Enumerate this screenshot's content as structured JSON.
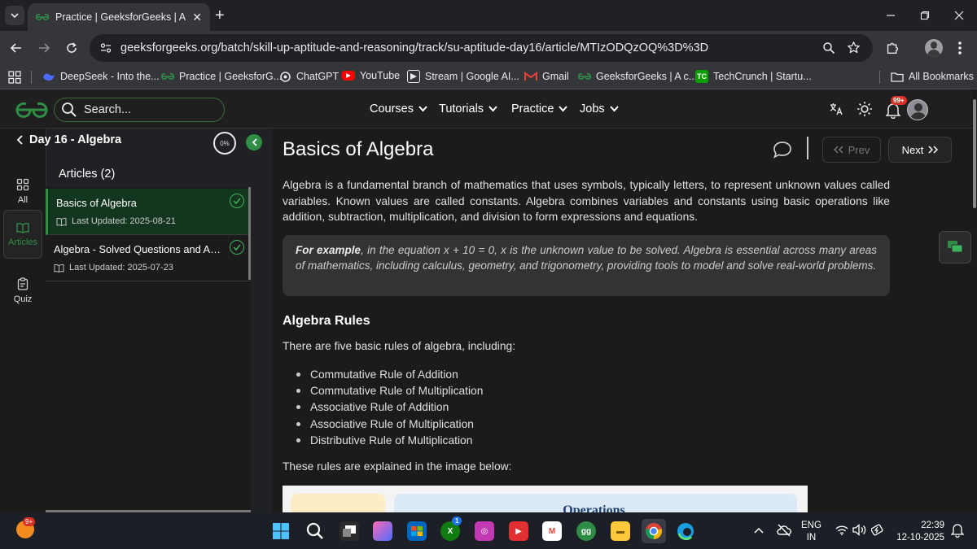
{
  "browser": {
    "tab_title": "Practice | GeeksforGeeks | A co",
    "tab_close": "✕",
    "new_tab": "+",
    "url": "geeksforgeeks.org/batch/skill-up-aptitude-and-reasoning/track/su-aptitude-day16/article/MTIzODQzOQ%3D%3D"
  },
  "bookmarks": {
    "items": [
      {
        "label": "DeepSeek - Into the...",
        "icon": "deepseek-icon"
      },
      {
        "label": "Practice | GeeksforG...",
        "icon": "gfg-icon"
      },
      {
        "label": "ChatGPT",
        "icon": "chatgpt-icon"
      },
      {
        "label": "YouTube",
        "icon": "youtube-icon"
      },
      {
        "label": "Stream | Google AI...",
        "icon": "stream-icon"
      },
      {
        "label": "Gmail",
        "icon": "gmail-icon"
      },
      {
        "label": "GeeksforGeeks | A c...",
        "icon": "gfg-icon"
      },
      {
        "label": "TechCrunch | Startu...",
        "icon": "techcrunch-icon",
        "glyph": "TC"
      }
    ],
    "all_bookmarks": "All Bookmarks"
  },
  "site_header": {
    "search_label": "Search...",
    "nav": [
      "Courses",
      "Tutorials",
      "Practice",
      "Jobs"
    ],
    "notification_badge": "99+",
    "brand_color": "#2f8d46"
  },
  "rail": {
    "items": [
      {
        "label": "All",
        "icon": "grid-icon"
      },
      {
        "label": "Articles",
        "icon": "book-icon"
      },
      {
        "label": "Quiz",
        "icon": "clipboard-icon"
      }
    ]
  },
  "sidebar": {
    "course_title": "Day 16 - Algebra",
    "progress": "0%",
    "articles_heading": "Articles (2)",
    "articles": [
      {
        "title": "Basics of Algebra",
        "updated": "Last Updated: 2025-08-21"
      },
      {
        "title": "Algebra - Solved Questions and Answers",
        "updated": "Last Updated: 2025-07-23"
      }
    ]
  },
  "article": {
    "title": "Basics of Algebra",
    "prev_label": "Prev",
    "next_label": "Next",
    "intro": "Algebra is a fundamental branch of mathematics that uses symbols, typically letters, to represent unknown values called variables. Known values are called constants. Algebra combines variables and constants using basic operations like addition, subtraction, multiplication, and division to form expressions and equations.",
    "example_lead": "For example",
    "example_text": ", in the equation x + 10 = 0, x is the unknown value to be solved. Algebra is essential across many areas of mathematics, including calculus, geometry, and trigonometry, providing tools to model and solve real-world problems.",
    "rules_heading": "Algebra Rules",
    "rules_intro": "There are five basic rules of algebra, including:",
    "rules": [
      "Commutative Rule of Addition",
      "Commutative Rule of Multiplication",
      "Associative Rule of Addition",
      "Associative Rule of Multiplication",
      "Distributive Rule of Multiplication"
    ],
    "rules_outro": "These rules are explained in the image below:",
    "image_label": "Operations"
  },
  "taskbar": {
    "weather_badge": "9+",
    "store_badge": "1",
    "lang_line1": "ENG",
    "lang_line2": "IN",
    "time": "22:39",
    "date": "12-10-2025"
  }
}
